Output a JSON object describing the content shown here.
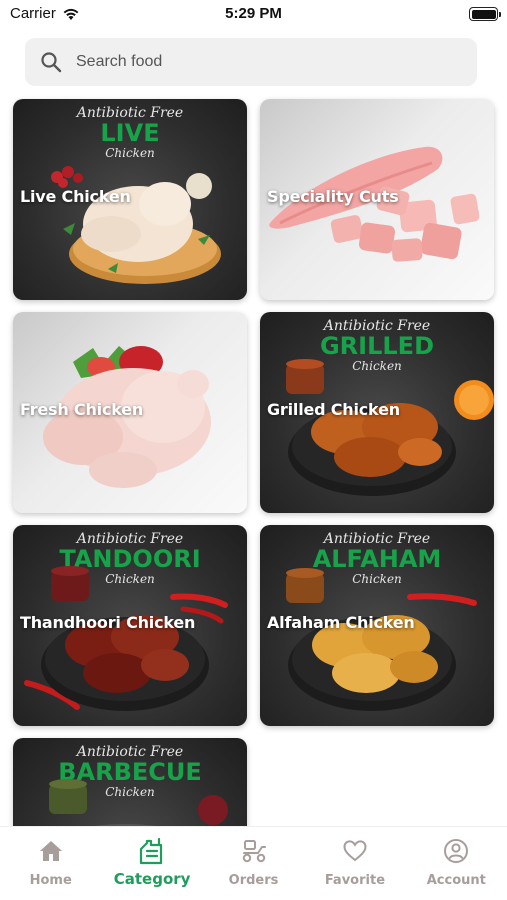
{
  "status_bar": {
    "carrier": "Carrier",
    "time": "5:29 PM"
  },
  "search": {
    "placeholder": "Search food"
  },
  "categories": [
    {
      "label": "Live Chicken",
      "banner_top": "Antibiotic Free",
      "banner_main": "LIVE",
      "banner_sub": "Chicken"
    },
    {
      "label": "Speciality Cuts"
    },
    {
      "label": "Fresh Chicken"
    },
    {
      "label": "Grilled Chicken",
      "banner_top": "Antibiotic Free",
      "banner_main": "GRILLED",
      "banner_sub": "Chicken"
    },
    {
      "label": "Thandhoori Chicken",
      "banner_top": "Antibiotic Free",
      "banner_main": "TANDOORI",
      "banner_sub": "Chicken"
    },
    {
      "label": "Alfaham Chicken",
      "banner_top": "Antibiotic Free",
      "banner_main": "ALFAHAM",
      "banner_sub": "Chicken"
    },
    {
      "label": "",
      "banner_top": "Antibiotic Free",
      "banner_main": "BARBECUE",
      "banner_sub": "Chicken"
    }
  ],
  "tabs": [
    {
      "label": "Home",
      "icon": "home-icon",
      "active": false
    },
    {
      "label": "Category",
      "icon": "category-icon",
      "active": true
    },
    {
      "label": "Orders",
      "icon": "delivery-scooter-icon",
      "active": false
    },
    {
      "label": "Favorite",
      "icon": "heart-icon",
      "active": false
    },
    {
      "label": "Account",
      "icon": "user-circle-icon",
      "active": false
    }
  ],
  "colors": {
    "accent": "#1f9d5c",
    "banner_green": "#17a34a",
    "inactive_tab": "#a79e9b",
    "card_dark": "#2d2d2d"
  }
}
